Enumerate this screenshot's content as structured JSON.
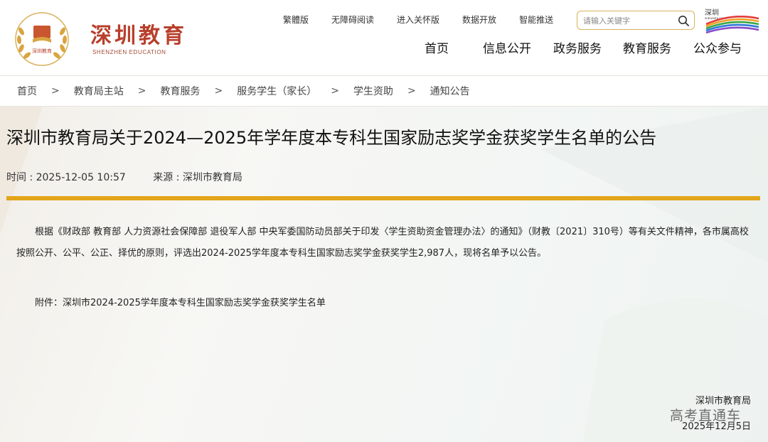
{
  "site": {
    "name": "深圳教育",
    "name_en": "SHENZHEN EDUCATION",
    "emblem_text": "深圳教育",
    "city_logo_text": "深圳",
    "city_logo_sub": "SHENZHEN CHINA"
  },
  "toplinks": [
    "繁體版",
    "无障碍阅读",
    "进入关怀版",
    "数据开放",
    "智能推送"
  ],
  "search": {
    "placeholder": "请输入关键字"
  },
  "nav": [
    "首页",
    "信息公开",
    "政务服务",
    "教育服务",
    "公众参与"
  ],
  "breadcrumb": [
    "首页",
    "教育局主站",
    "教育服务",
    "服务学生（家长）",
    "学生资助",
    "通知公告"
  ],
  "breadcrumb_sep": ">",
  "article": {
    "title": "深圳市教育局关于2024—2025年学年度本专科生国家励志奖学金获奖学生名单的公告",
    "time": "时间 : 2025-12-05 10:57",
    "source": "来源 : 深圳市教育局",
    "body": "根据《财政部 教育部 人力资源社会保障部 退役军人部 中央军委国防动员部关于印发〈学生资助资金管理办法〉的通知》（财教〔2021〕310号）等有关文件精神，各市属高校按照公开、公平、公正、择优的原则，评选出2024-2025学年度本专科生国家励志奖学金获奖学生2,987人，现将名单予以公告。",
    "attachment": "附件：深圳市2024-2025学年度本专科生国家励志奖学金获奖学生名单",
    "signature_org": "深圳市教育局",
    "signature_date": "2025年12月5日"
  },
  "watermark": "高考直通车",
  "colors": {
    "brand_red": "#b8402c",
    "accent_gold": "#e3a51a",
    "search_border": "#d9b15a"
  },
  "icons": [
    "laurel-emblem-icon",
    "search-icon",
    "shenzhen-city-logo-icon"
  ]
}
